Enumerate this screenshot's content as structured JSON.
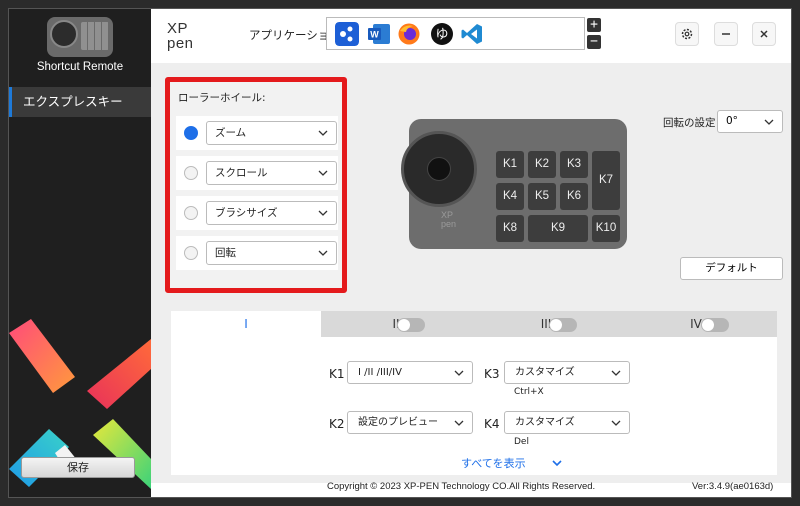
{
  "sidebar": {
    "device_name": "Shortcut Remote",
    "nav_item": "エクスプレスキー",
    "save_label": "保存"
  },
  "logo": {
    "line1": "XP",
    "line2": "pen"
  },
  "toolbar": {
    "app_label": "アプリケーション:",
    "apps": [
      "xppen-icon",
      "word-icon",
      "firefox-icon",
      "yu-icon",
      "vscode-icon"
    ],
    "plus": "+",
    "minus": "−"
  },
  "roller": {
    "title": "ローラーホイール:",
    "options": [
      {
        "value": "ズーム",
        "selected": true
      },
      {
        "value": "スクロール",
        "selected": false
      },
      {
        "value": "ブラシサイズ",
        "selected": false
      },
      {
        "value": "回転",
        "selected": false
      }
    ]
  },
  "device": {
    "brand_line1": "XP",
    "brand_line2": "pen",
    "keys": [
      "K1",
      "K2",
      "K3",
      "K4",
      "K5",
      "K6",
      "K7",
      "K8",
      "K9",
      "K10"
    ]
  },
  "rotation": {
    "label": "回転の設定",
    "value": "0°"
  },
  "default_label": "デフォルト",
  "tabs": [
    {
      "label": "I",
      "active": true
    },
    {
      "label": "II",
      "active": false
    },
    {
      "label": "III",
      "active": false
    },
    {
      "label": "IV",
      "active": false
    }
  ],
  "key_settings": [
    {
      "key": "K1",
      "value": "I /II /III/IV",
      "sub": ""
    },
    {
      "key": "K3",
      "value": "カスタマイズ",
      "sub": "Ctrl+X"
    },
    {
      "key": "K2",
      "value": "設定のプレビュー",
      "sub": ""
    },
    {
      "key": "K4",
      "value": "カスタマイズ",
      "sub": "Del"
    }
  ],
  "show_all": "すべてを表示",
  "footer": {
    "copyright": "Copyright © 2023  XP-PEN Technology CO.All Rights Reserved.",
    "version": "Ver:3.4.9(ae0163d)"
  },
  "colors": {
    "accent": "#1e6fe8",
    "highlight": "#e41a1c",
    "sidebar": "#1f1f1f"
  }
}
